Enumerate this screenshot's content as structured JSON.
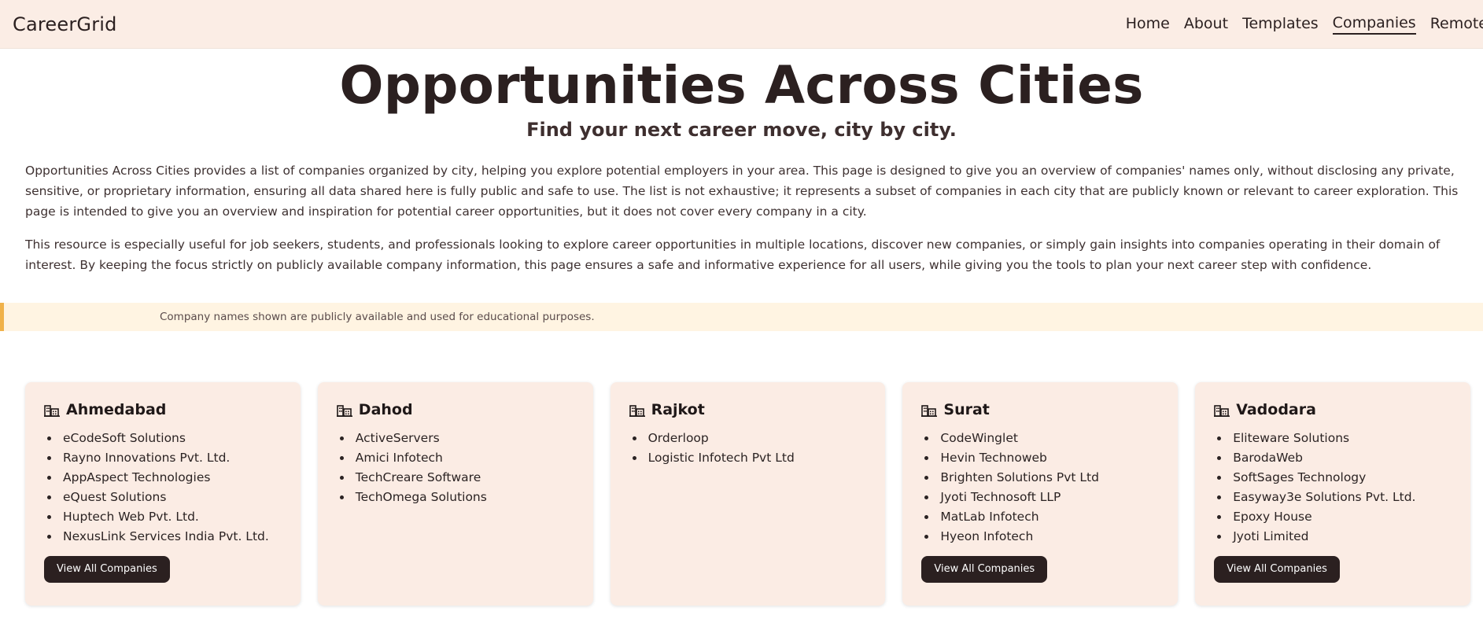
{
  "brand": "CareerGrid",
  "nav": {
    "items": [
      {
        "label": "Home",
        "active": false
      },
      {
        "label": "About",
        "active": false
      },
      {
        "label": "Templates",
        "active": false
      },
      {
        "label": "Companies",
        "active": true
      },
      {
        "label": "Remote",
        "active": false
      }
    ]
  },
  "hero": {
    "title": "Opportunities Across Cities",
    "subtitle": "Find your next career move, city by city."
  },
  "intro": {
    "paragraph1": "Opportunities Across Cities provides a list of companies organized by city, helping you explore potential employers in your area. This page is designed to give you an overview of companies' names only, without disclosing any private, sensitive, or proprietary information, ensuring all data shared here is fully public and safe to use. The list is not exhaustive; it represents a subset of companies in each city that are publicly known or relevant to career exploration. This page is intended to give you an overview and inspiration for potential career opportunities, but it does not cover every company in a city.",
    "paragraph2": "This resource is especially useful for job seekers, students, and professionals looking to explore career opportunities in multiple locations, discover new companies, or simply gain insights into companies operating in their domain of interest. By keeping the focus strictly on publicly available company information, this page ensures a safe and informative experience for all users, while giving you the tools to plan your next career step with confidence."
  },
  "notice": "Company names shown are publicly available and used for educational purposes.",
  "cities": [
    {
      "name": "Ahmedabad",
      "icon": "city-icon",
      "companies": [
        "eCodeSoft Solutions",
        "Rayno Innovations Pvt. Ltd.",
        "AppAspect Technologies",
        "eQuest Solutions",
        "Huptech Web Pvt. Ltd.",
        "NexusLink Services India Pvt. Ltd."
      ],
      "button": "View All Companies"
    },
    {
      "name": "Dahod",
      "icon": "city-icon",
      "companies": [
        "ActiveServers",
        "Amici Infotech",
        "TechCreare Software",
        "TechOmega Solutions"
      ],
      "button": null
    },
    {
      "name": "Rajkot",
      "icon": "city-icon",
      "companies": [
        "Orderloop",
        "Logistic Infotech Pvt Ltd"
      ],
      "button": null
    },
    {
      "name": "Surat",
      "icon": "city-icon",
      "companies": [
        "CodeWinglet",
        "Hevin Technoweb",
        "Brighten Solutions Pvt Ltd",
        "Jyoti Technosoft LLP",
        "MatLab Infotech",
        "Hyeon Infotech"
      ],
      "button": "View All Companies"
    },
    {
      "name": "Vadodara",
      "icon": "city-icon",
      "companies": [
        "Eliteware Solutions",
        "BarodaWeb",
        "SoftSages Technology",
        "Easyway3e Solutions Pvt. Ltd.",
        "Epoxy House",
        "Jyoti Limited"
      ],
      "button": "View All Companies"
    }
  ],
  "colors": {
    "header_bg": "#fbede5",
    "card_bg": "#fbece4",
    "button_bg": "#2b2020",
    "notice_bg": "#fff4e2",
    "notice_accent": "#f0b24a"
  }
}
